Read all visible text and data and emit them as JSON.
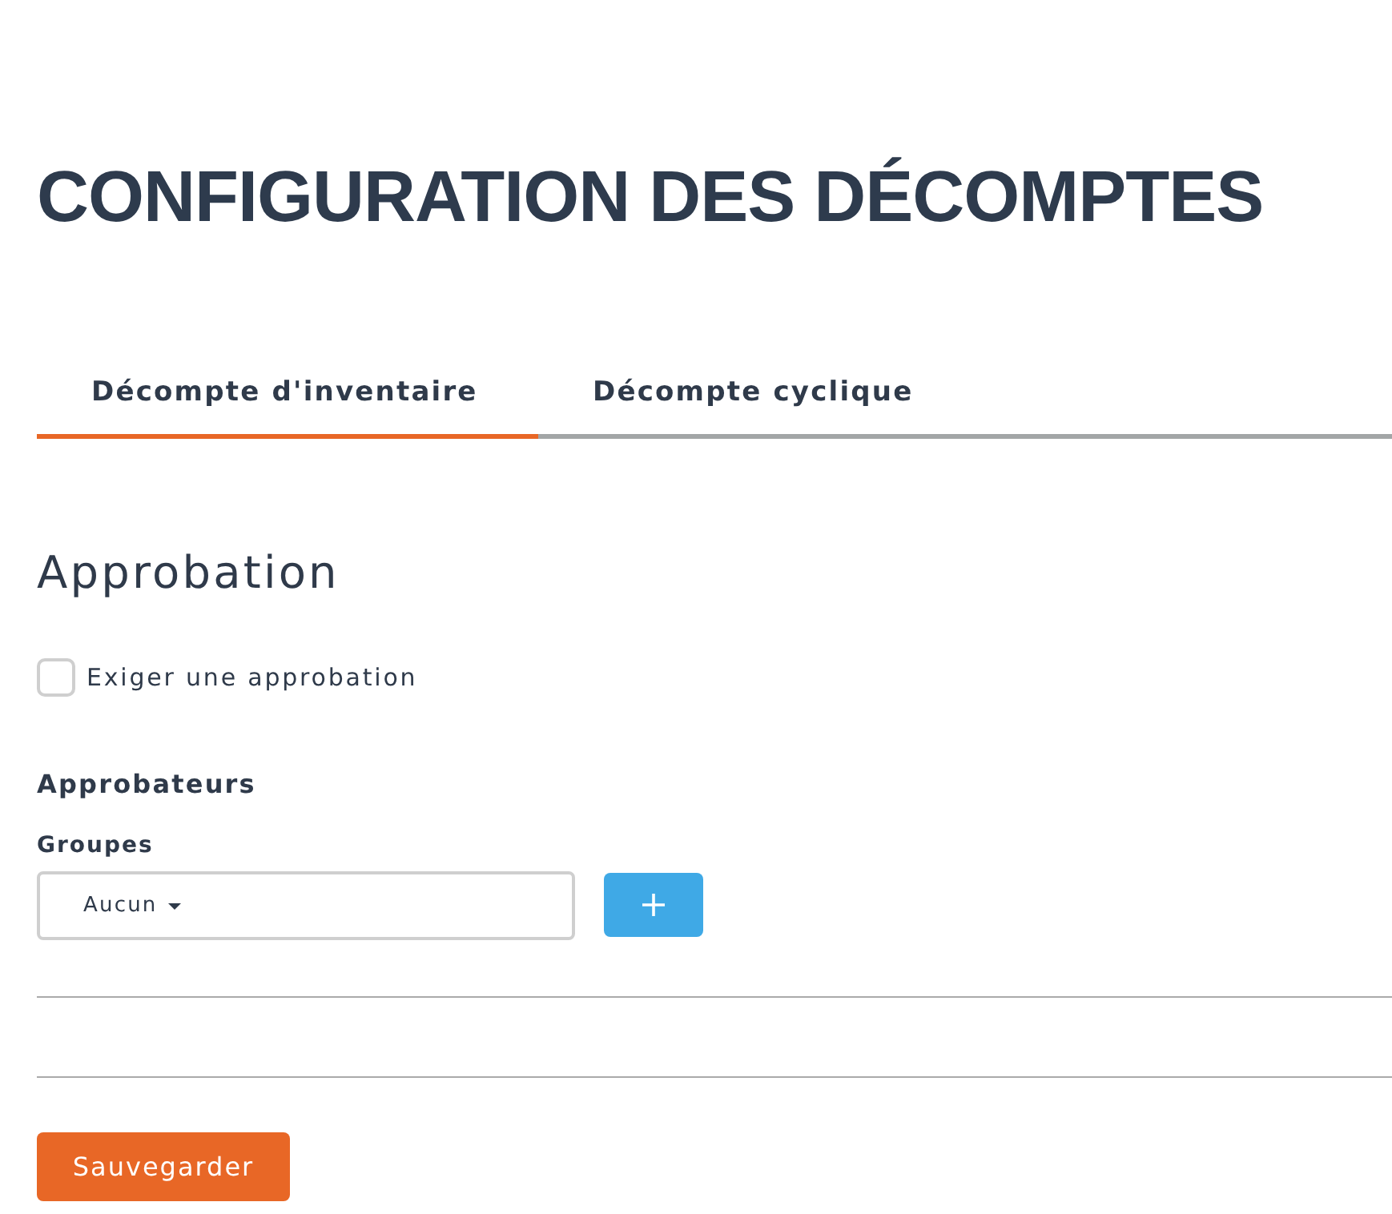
{
  "title": "CONFIGURATION DES DÉCOMPTES",
  "tabs": [
    {
      "label": "Décompte d'inventaire",
      "selected": true
    },
    {
      "label": "Décompte cyclique",
      "selected": false
    }
  ],
  "approval": {
    "heading": "Approbation",
    "require_checkbox": {
      "label": "Exiger une approbation",
      "checked": false
    }
  },
  "approvers": {
    "heading": "Approbateurs",
    "groups": {
      "label": "Groupes",
      "value": "Aucun"
    }
  },
  "save_button": "Sauvegarder"
}
